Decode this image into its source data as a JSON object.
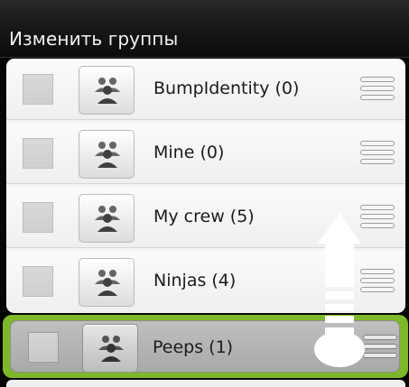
{
  "title": "Изменить группы",
  "groups": [
    {
      "label": "BumpIdentity (0)",
      "checked": false
    },
    {
      "label": "Mine (0)",
      "checked": false
    },
    {
      "label": "My crew (5)",
      "checked": false
    },
    {
      "label": "Ninjas (4)",
      "checked": false
    },
    {
      "label": "Peeps (1)",
      "checked": false,
      "dragging": true
    }
  ],
  "icons": {
    "group": "group-people-icon",
    "handle": "drag-handle-icon",
    "hint": "drag-up-arrow-hint"
  },
  "colors": {
    "title_bar": "#141414",
    "drag_highlight": "#7cb82a",
    "row_background": "#f3f3f3"
  }
}
